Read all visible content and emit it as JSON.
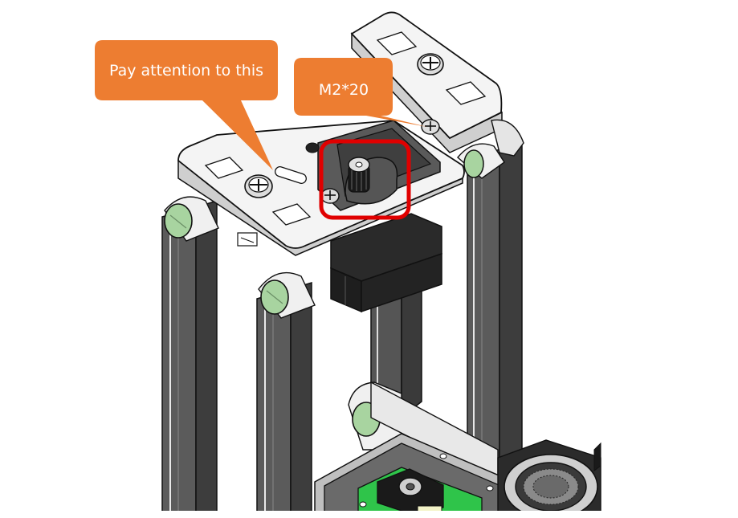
{
  "callouts": {
    "attention": {
      "text": "Pay attention to this"
    },
    "screw": {
      "text": "M2*20"
    }
  },
  "colors": {
    "callout_fill": "#ED7D31",
    "callout_text": "#FFFFFF",
    "highlight_box": "#E00000",
    "part_plate": "#F2F2F2",
    "part_outline": "#111111",
    "column_dark": "#4A4A4A",
    "cap_green": "#A8D4A0",
    "board_green": "#2FC44A",
    "servo_black": "#1E1E1E"
  },
  "icons": {
    "screw": "phillips-screw-head-icon",
    "camera": "camera-module-icon",
    "speaker": "speaker-grille-icon"
  }
}
